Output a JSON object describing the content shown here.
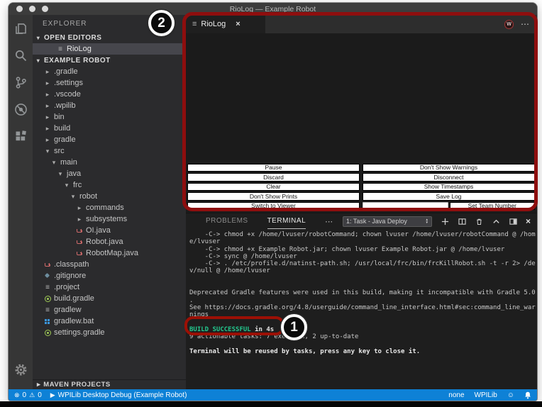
{
  "window": {
    "title": "RioLog — Example Robot"
  },
  "icons": {
    "traffic_lights": "css-circles",
    "files": "svg",
    "search": "svg",
    "source_control": "svg",
    "debug": "svg",
    "extensions": "svg",
    "settings_gear": "svg",
    "list": "≡",
    "chevron_right": "▸",
    "chevron_down": "▾",
    "java": "css-cup",
    "git": "css-diamond",
    "gradle": "css-circle-dot",
    "windows": "css-grid",
    "close": "×",
    "more": "⋯",
    "wpilib_badge": "W",
    "select_arrow_up": "▲",
    "select_arrow_down": "▼",
    "errors": "⊗",
    "warnings": "⚠",
    "debug_run": "▶",
    "feedback": "☺",
    "notifications": "svg-bell"
  },
  "sidebar": {
    "title": "EXPLORER",
    "open_editors_header": "OPEN EDITORS",
    "open_editors": [
      {
        "label": "RioLog",
        "icon": "list",
        "indent": 3,
        "selected": true
      }
    ],
    "project_header": "EXAMPLE ROBOT",
    "tree": [
      {
        "label": ".gradle",
        "chevron": "right",
        "indent": 1
      },
      {
        "label": ".settings",
        "chevron": "right",
        "indent": 1
      },
      {
        "label": ".vscode",
        "chevron": "right",
        "indent": 1
      },
      {
        "label": ".wpilib",
        "chevron": "right",
        "indent": 1
      },
      {
        "label": "bin",
        "chevron": "right",
        "indent": 1
      },
      {
        "label": "build",
        "chevron": "right",
        "indent": 1
      },
      {
        "label": "gradle",
        "chevron": "right",
        "indent": 1
      },
      {
        "label": "src",
        "chevron": "down",
        "indent": 1
      },
      {
        "label": "main",
        "chevron": "down",
        "indent": 2
      },
      {
        "label": "java",
        "chevron": "down",
        "indent": 3
      },
      {
        "label": "frc",
        "chevron": "down",
        "indent": 4
      },
      {
        "label": "robot",
        "chevron": "down",
        "indent": 5
      },
      {
        "label": "commands",
        "chevron": "right",
        "indent": 6
      },
      {
        "label": "subsystems",
        "chevron": "right",
        "indent": 6
      },
      {
        "label": "OI.java",
        "icon": "java",
        "indent": 6
      },
      {
        "label": "Robot.java",
        "icon": "java",
        "indent": 6
      },
      {
        "label": "RobotMap.java",
        "icon": "java",
        "indent": 6
      },
      {
        "label": ".classpath",
        "icon": "java",
        "indent": 1
      },
      {
        "label": ".gitignore",
        "icon": "git",
        "indent": 1
      },
      {
        "label": ".project",
        "icon": "list",
        "indent": 1
      },
      {
        "label": "build.gradle",
        "icon": "gradle",
        "indent": 1
      },
      {
        "label": "gradlew",
        "icon": "list",
        "indent": 1
      },
      {
        "label": "gradlew.bat",
        "icon": "windows",
        "indent": 1
      },
      {
        "label": "settings.gradle",
        "icon": "gradle",
        "indent": 1
      }
    ],
    "maven_header": "MAVEN PROJECTS"
  },
  "editor": {
    "tab": {
      "label": "RioLog",
      "close": "×"
    },
    "actions": {
      "wpilib_badge": "W",
      "more": "⋯"
    },
    "riolog": {
      "left_buttons": [
        {
          "label": "Pause"
        },
        {
          "label": "Discard"
        },
        {
          "label": "Clear"
        },
        {
          "label": "Don't Show Prints"
        },
        {
          "label": "Switch to Viewer"
        }
      ],
      "right_buttons": [
        {
          "label": "Don't Show Warnings"
        },
        {
          "label": "Disconnect"
        },
        {
          "label": "Show Timestamps"
        },
        {
          "label": "Save Log"
        }
      ],
      "team_input_value": "",
      "set_team_label": "Set Team Number"
    }
  },
  "terminal_panel": {
    "tabs": [
      {
        "label": "PROBLEMS",
        "active": false
      },
      {
        "label": "TERMINAL",
        "active": true
      }
    ],
    "more": "⋯",
    "picker_value": "1: Task - Java Deploy",
    "lines_before": [
      {
        "text": "    -C-> chmod +x /home/lvuser/robotCommand; chown lvuser /home/lvuser/robotCommand @ /hom"
      },
      {
        "text": "e/lvuser"
      },
      {
        "text": "    -C-> chmod +x Example Robot.jar; chown lvuser Example Robot.jar @ /home/lvuser"
      },
      {
        "text": "    -C-> sync @ /home/lvuser"
      },
      {
        "text": "    -C-> . /etc/profile.d/natinst-path.sh; /usr/local/frc/bin/frcKillRobot.sh -t -r 2> /de"
      },
      {
        "text": "v/null @ /home/lvuser"
      },
      {
        "text": ""
      },
      {
        "text": ""
      },
      {
        "text": "Deprecated Gradle features were used in this build, making it incompatible with Gradle 5.0"
      },
      {
        "text": "."
      },
      {
        "text": "See https://docs.gradle.org/4.8/userguide/command_line_interface.html#sec:command_line_war"
      },
      {
        "text": "nings"
      },
      {
        "text": ""
      }
    ],
    "build_success": "BUILD SUCCESSFUL",
    "build_rest": " in 4s",
    "lines_after": [
      {
        "text": "9 actionable tasks: 7 executed, 2 up-to-date"
      },
      {
        "text": ""
      },
      {
        "text": "Terminal will be reused by tasks, press any key to close it.",
        "bold": true
      }
    ]
  },
  "status_bar": {
    "errors": "0",
    "warnings": "0",
    "debug_label": "WPILib Desktop Debug (Example Robot)",
    "lang_mode": "none",
    "wpilib_label": "WPILib"
  },
  "annotations": {
    "editor_circle": "2",
    "build_circle": "1"
  },
  "colors": {
    "status_bar": "#0e81d6",
    "highlight_red": "#8e0e0e",
    "build_success_green": "#23c88e",
    "titlebar": "#3c3c3c"
  }
}
